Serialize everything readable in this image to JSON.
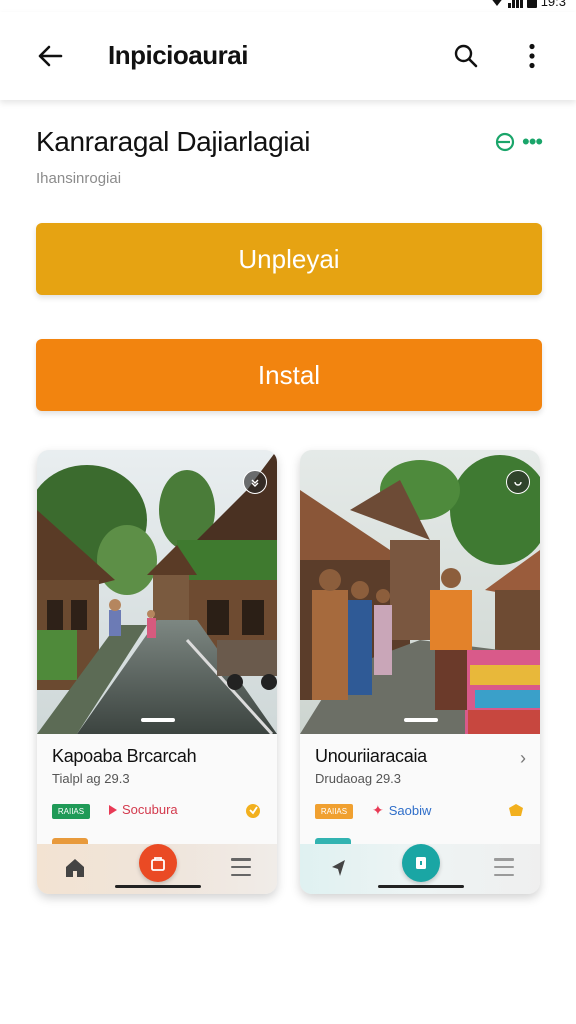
{
  "status_bar": {
    "time": "19:3"
  },
  "app_bar": {
    "title": "Inpicioaurai",
    "back_icon": "arrow-left-icon",
    "search_icon": "search-icon",
    "more_icon": "more-vertical-icon"
  },
  "header": {
    "app_name": "Kanraragal Dajiarlagiai",
    "subtitle": "Ihansinrogiai",
    "action_icon": "share-green-icon",
    "action_dots": "•••"
  },
  "buttons": {
    "primary_label": "Unpleyai",
    "install_label": "Instal",
    "primary_color": "#e6a312",
    "install_color": "#f2840f"
  },
  "cards": [
    {
      "title": "Kapoaba Brcarcah",
      "meta": "Tialpl ag 29.3",
      "tag_label": "RAIIAS",
      "tag_color": "#1f9a57",
      "link_label": "Socubura",
      "link_icon": "play-icon",
      "end_icon": "coin-icon",
      "nav_home_icon": "home-icon",
      "nav_center_icon": "bag-icon",
      "nav_menu_icon": "menu-icon",
      "accent": "#ea4a24"
    },
    {
      "title": "Unouriiaracaia",
      "meta": "Drudaoag 29.3",
      "tag_label": "RAIIAS",
      "tag_color": "#f0a030",
      "link_label": "Saobiw",
      "link_icon": "sparkle-icon",
      "chevron": "›",
      "end_icon": "ticket-icon",
      "nav_home_icon": "navigation-icon",
      "nav_center_icon": "lock-icon",
      "nav_menu_icon": "menu-icon",
      "accent": "#1aa6a4"
    }
  ]
}
